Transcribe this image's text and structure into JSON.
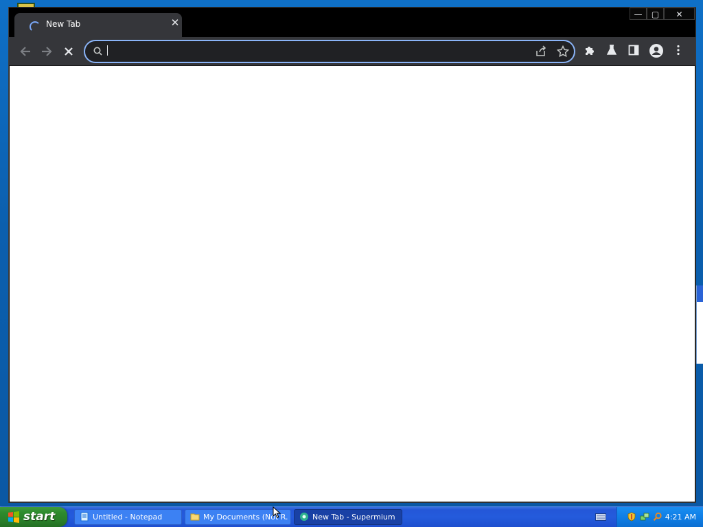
{
  "browser": {
    "tab": {
      "title": "New Tab",
      "close_icon": "close-icon",
      "loading_icon": "loading-spinner-icon"
    },
    "window_controls": {
      "minimize": "—",
      "maximize": "▢",
      "close": "✕"
    },
    "toolbar": {
      "back_icon": "arrow-back-icon",
      "forward_icon": "arrow-forward-icon",
      "stop_icon": "stop-loading-icon",
      "omnibox": {
        "value": "",
        "search_icon": "search-icon",
        "share_icon": "share-icon",
        "bookmark_icon": "star-icon"
      },
      "right_icons": [
        "extensions-icon",
        "labs-flask-icon",
        "side-panel-icon",
        "profile-icon",
        "menu-icon"
      ]
    },
    "accent_color": "#8ab4f8"
  },
  "taskbar": {
    "start_label": "start",
    "buttons": [
      {
        "label": "Untitled - Notepad",
        "icon": "notepad-icon",
        "active": false
      },
      {
        "label": "My Documents (Not R...",
        "icon": "folder-icon",
        "active": false
      },
      {
        "label": "New Tab - Supermium",
        "icon": "browser-icon",
        "active": true
      }
    ],
    "tray": {
      "icons": [
        "security-shield-icon",
        "network-icon",
        "search-icon"
      ],
      "clock": "4:21 AM"
    }
  }
}
